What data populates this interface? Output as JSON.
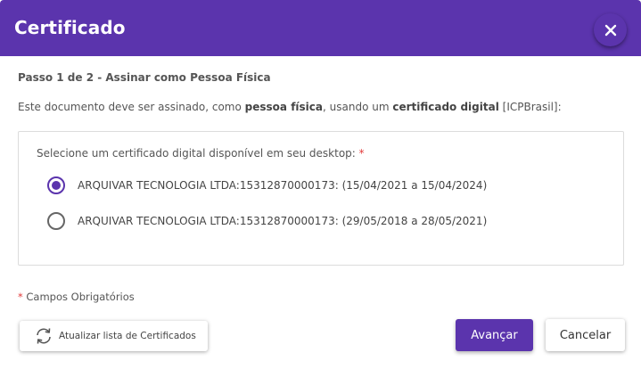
{
  "colors": {
    "brand": "#5b34ad",
    "required": "#e23b3b"
  },
  "dialog": {
    "title": "Certificado",
    "close_icon": "close-icon"
  },
  "step": {
    "label": "Passo 1 de 2 - Assinar como Pessoa Física"
  },
  "description": {
    "part1": "Este documento deve ser assinado, como ",
    "bold1": "pessoa física",
    "part2": ", usando um ",
    "bold2": "certificado digital",
    "part3": " [ICPBrasil]:"
  },
  "certificates": {
    "label": "Selecione um certificado digital disponível em seu desktop:",
    "required_mark": "*",
    "options": [
      {
        "label": "ARQUIVAR TECNOLOGIA LTDA:15312870000173: (15/04/2021 a 15/04/2024)",
        "selected": true
      },
      {
        "label": "ARQUIVAR TECNOLOGIA LTDA:15312870000173: (29/05/2018 a 28/05/2021)",
        "selected": false
      }
    ]
  },
  "required_note": {
    "mark": "*",
    "text": " Campos Obrigatórios"
  },
  "footer": {
    "refresh_label": "Atualizar lista de Certificados",
    "refresh_icon": "refresh-icon",
    "next_label": "Avançar",
    "cancel_label": "Cancelar"
  }
}
